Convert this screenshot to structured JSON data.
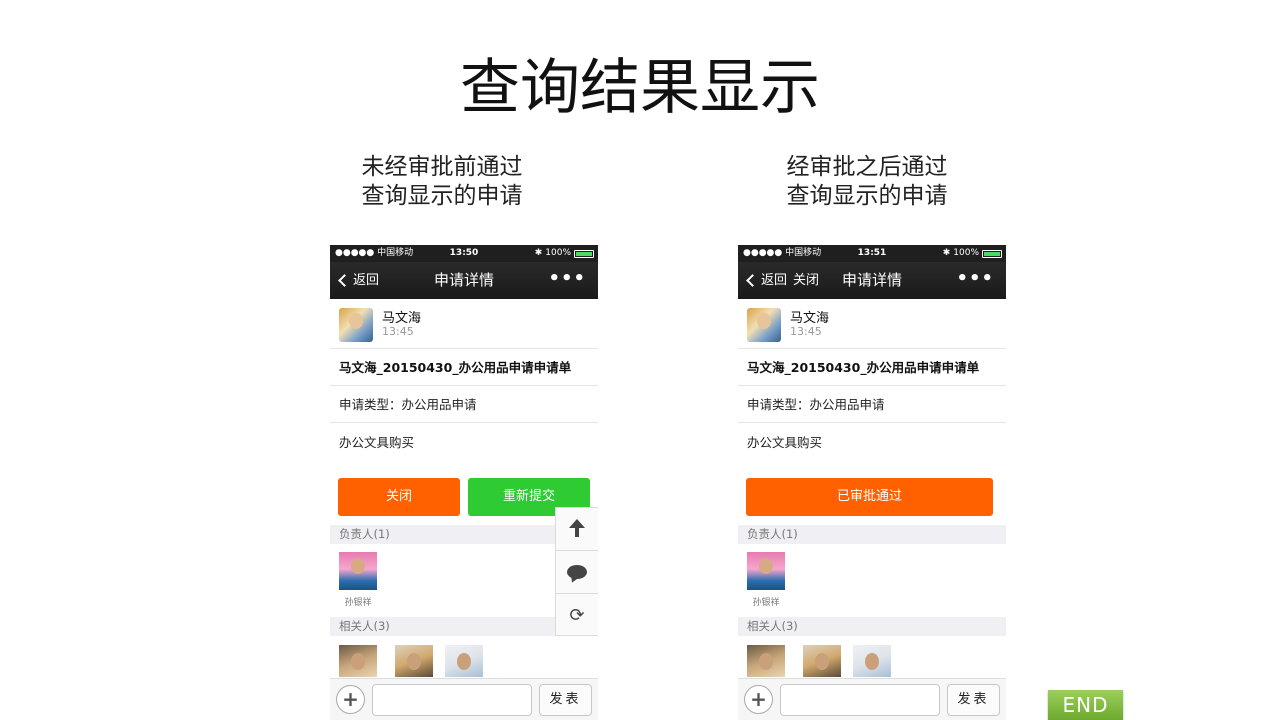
{
  "slide": {
    "title": "查询结果显示",
    "end_label": "END"
  },
  "left": {
    "caption_line1": "未经审批前通过",
    "caption_line2": "查询显示的申请",
    "status": {
      "carrier": "●●●●● 中国移动",
      "time": "13:50",
      "battery": "100%"
    },
    "nav": {
      "back": "返回",
      "title": "申请详情",
      "more": "•••"
    },
    "user": {
      "name": "马文海",
      "time": "13:45"
    },
    "form_title": "马文海_20150430_办公用品申请申请单",
    "type_line": "申请类型：办公用品申请",
    "desc": "办公文具购买",
    "buttons": {
      "close": "关闭",
      "resubmit": "重新提交"
    },
    "owner_header": "负责人(1)",
    "owner": {
      "name": "孙银祥"
    },
    "related_header": "相关人(3)",
    "input": {
      "plus": "+",
      "placeholder": "",
      "send": "发表"
    }
  },
  "right": {
    "caption_line1": "经审批之后通过",
    "caption_line2": "查询显示的申请",
    "status": {
      "carrier": "●●●●● 中国移动",
      "time": "13:51",
      "battery": "100%"
    },
    "nav": {
      "back": "返回",
      "close": "关闭",
      "title": "申请详情",
      "more": "•••"
    },
    "user": {
      "name": "马文海",
      "time": "13:45"
    },
    "form_title": "马文海_20150430_办公用品申请申请单",
    "type_line": "申请类型：办公用品申请",
    "desc": "办公文具购买",
    "buttons": {
      "approved": "已审批通过"
    },
    "owner_header": "负责人(1)",
    "owner": {
      "name": "孙银祥"
    },
    "related_header": "相关人(3)",
    "input": {
      "plus": "+",
      "placeholder": "",
      "send": "发表"
    }
  },
  "colors": {
    "orange": "#ff6000",
    "green": "#2fcb33",
    "end_green": "#7cbb3c"
  }
}
